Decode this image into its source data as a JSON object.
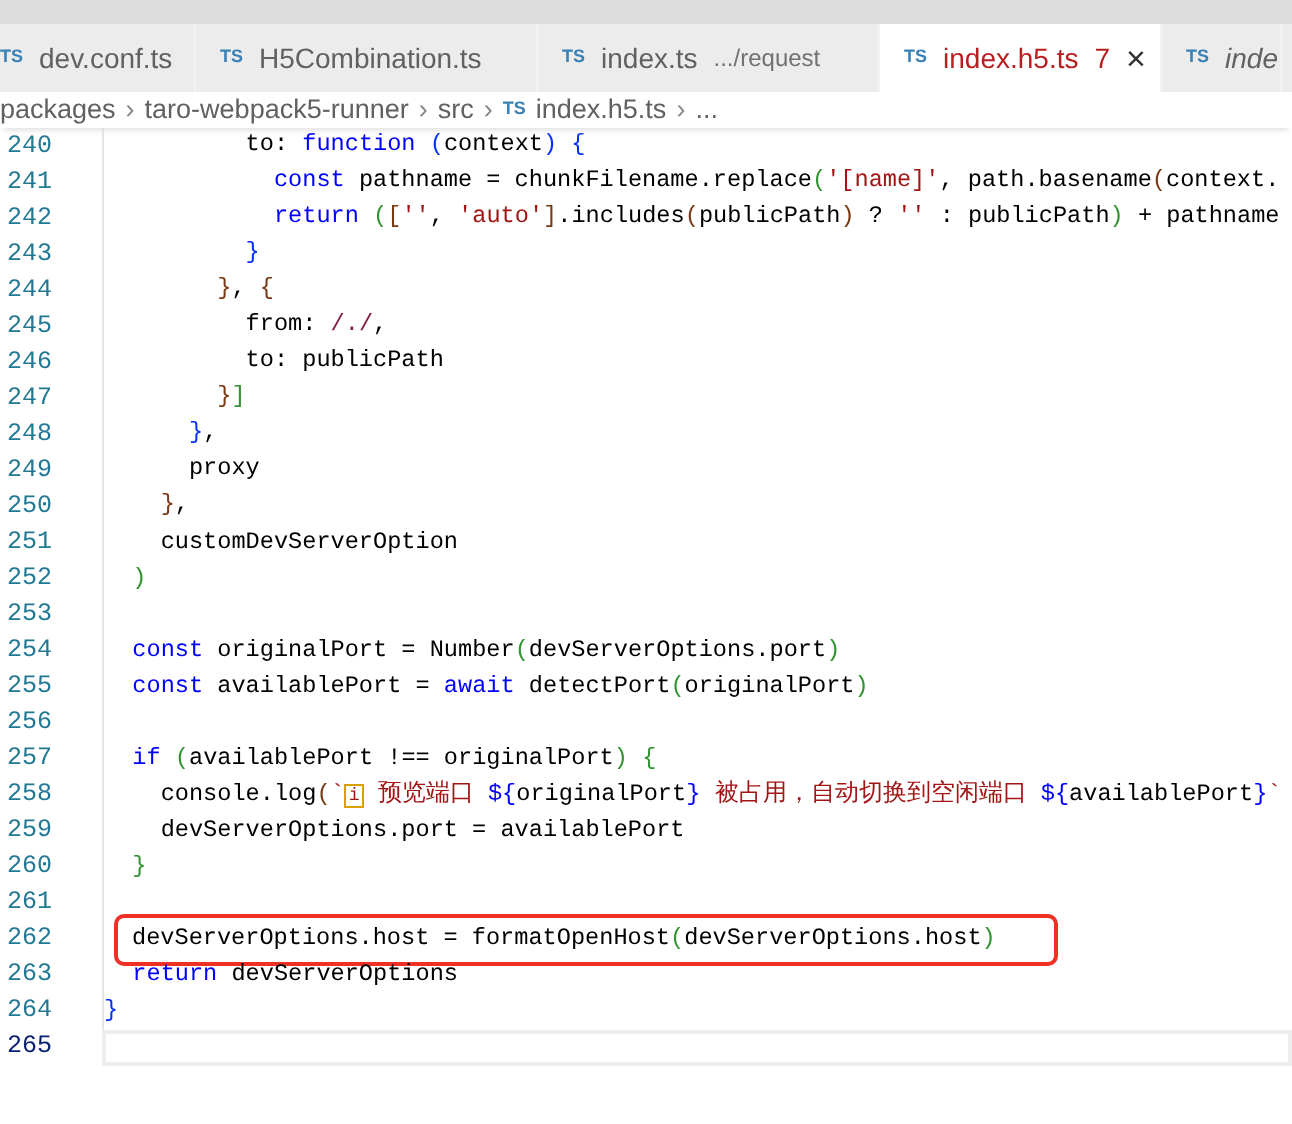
{
  "tabs": [
    {
      "icon_text": "TS",
      "label": "dev.conf.ts",
      "selected": false,
      "preview": false
    },
    {
      "icon_text": "TS",
      "label": "H5Combination.ts",
      "selected": false,
      "preview": false
    },
    {
      "icon_text": "TS",
      "label": "index.ts",
      "description": ".../request",
      "selected": false,
      "preview": false
    },
    {
      "icon_text": "TS",
      "label": "index.h5.ts",
      "problems": "7",
      "selected": true,
      "preview": false,
      "close": "×"
    },
    {
      "icon_text": "TS",
      "label": "inde",
      "selected": false,
      "preview": true
    }
  ],
  "breadcrumbs": [
    {
      "label": "packages"
    },
    {
      "label": "taro-webpack5-runner"
    },
    {
      "label": "src"
    },
    {
      "label": "index.h5.ts",
      "icon_text": "TS"
    },
    {
      "label": "..."
    }
  ],
  "breadcrumb_separator": "›",
  "code_lines": [
    {
      "number": "240",
      "current": false,
      "highlighted": false,
      "tokens": [
        {
          "kind": "plain",
          "text": "          to: "
        },
        {
          "kind": "keyword",
          "text": "function"
        },
        {
          "kind": "bracket1",
          "text": " ("
        },
        {
          "kind": "plain",
          "text": "context"
        },
        {
          "kind": "bracket1",
          "text": ")"
        },
        {
          "kind": "bracket1",
          "text": " {"
        }
      ]
    },
    {
      "number": "241",
      "current": false,
      "highlighted": false,
      "tokens": [
        {
          "kind": "keyword",
          "text": "            const"
        },
        {
          "kind": "plain",
          "text": " pathname = chunkFilename.replace"
        },
        {
          "kind": "bracket2",
          "text": "("
        },
        {
          "kind": "string",
          "text": "'[name]'"
        },
        {
          "kind": "plain",
          "text": ", path.basename"
        },
        {
          "kind": "bracket3",
          "text": "("
        },
        {
          "kind": "plain",
          "text": "context."
        }
      ]
    },
    {
      "number": "242",
      "current": false,
      "highlighted": false,
      "tokens": [
        {
          "kind": "keyword",
          "text": "            return"
        },
        {
          "kind": "bracket2",
          "text": " ("
        },
        {
          "kind": "bracket3",
          "text": "["
        },
        {
          "kind": "string",
          "text": "''"
        },
        {
          "kind": "plain",
          "text": ", "
        },
        {
          "kind": "string",
          "text": "'auto'"
        },
        {
          "kind": "bracket3",
          "text": "]"
        },
        {
          "kind": "plain",
          "text": ".includes"
        },
        {
          "kind": "bracket3",
          "text": "("
        },
        {
          "kind": "plain",
          "text": "publicPath"
        },
        {
          "kind": "bracket3",
          "text": ")"
        },
        {
          "kind": "plain",
          "text": " ? "
        },
        {
          "kind": "string",
          "text": "''"
        },
        {
          "kind": "plain",
          "text": " : publicPath"
        },
        {
          "kind": "bracket2",
          "text": ")"
        },
        {
          "kind": "plain",
          "text": " + pathname"
        }
      ]
    },
    {
      "number": "243",
      "current": false,
      "highlighted": false,
      "tokens": [
        {
          "kind": "bracket1",
          "text": "          }"
        }
      ]
    },
    {
      "number": "244",
      "current": false,
      "highlighted": false,
      "tokens": [
        {
          "kind": "bracket3",
          "text": "        }"
        },
        {
          "kind": "plain",
          "text": ", "
        },
        {
          "kind": "bracket3",
          "text": "{"
        }
      ]
    },
    {
      "number": "245",
      "current": false,
      "highlighted": false,
      "tokens": [
        {
          "kind": "plain",
          "text": "          from: "
        },
        {
          "kind": "regex",
          "text": "/./"
        },
        {
          "kind": "plain",
          "text": ","
        }
      ]
    },
    {
      "number": "246",
      "current": false,
      "highlighted": false,
      "tokens": [
        {
          "kind": "plain",
          "text": "          to: publicPath"
        }
      ]
    },
    {
      "number": "247",
      "current": false,
      "highlighted": false,
      "tokens": [
        {
          "kind": "bracket3",
          "text": "        }"
        },
        {
          "kind": "bracket2",
          "text": "]"
        }
      ]
    },
    {
      "number": "248",
      "current": false,
      "highlighted": false,
      "tokens": [
        {
          "kind": "bracket1",
          "text": "      }"
        },
        {
          "kind": "plain",
          "text": ","
        }
      ]
    },
    {
      "number": "249",
      "current": false,
      "highlighted": false,
      "tokens": [
        {
          "kind": "plain",
          "text": "      proxy"
        }
      ]
    },
    {
      "number": "250",
      "current": false,
      "highlighted": false,
      "tokens": [
        {
          "kind": "bracket3",
          "text": "    }"
        },
        {
          "kind": "plain",
          "text": ","
        }
      ]
    },
    {
      "number": "251",
      "current": false,
      "highlighted": false,
      "tokens": [
        {
          "kind": "plain",
          "text": "    customDevServerOption"
        }
      ]
    },
    {
      "number": "252",
      "current": false,
      "highlighted": false,
      "tokens": [
        {
          "kind": "bracket2",
          "text": "  )"
        }
      ]
    },
    {
      "number": "253",
      "current": false,
      "highlighted": false
    },
    {
      "number": "254",
      "current": false,
      "highlighted": false,
      "tokens": [
        {
          "kind": "keyword",
          "text": "  const"
        },
        {
          "kind": "plain",
          "text": " originalPort = Number"
        },
        {
          "kind": "bracket2",
          "text": "("
        },
        {
          "kind": "plain",
          "text": "devServerOptions.port"
        },
        {
          "kind": "bracket2",
          "text": ")"
        }
      ]
    },
    {
      "number": "255",
      "current": false,
      "highlighted": false,
      "tokens": [
        {
          "kind": "keyword",
          "text": "  const"
        },
        {
          "kind": "plain",
          "text": " availablePort = "
        },
        {
          "kind": "keyword",
          "text": "await"
        },
        {
          "kind": "plain",
          "text": " detectPort"
        },
        {
          "kind": "bracket2",
          "text": "("
        },
        {
          "kind": "plain",
          "text": "originalPort"
        },
        {
          "kind": "bracket2",
          "text": ")"
        }
      ]
    },
    {
      "number": "256",
      "current": false,
      "highlighted": false
    },
    {
      "number": "257",
      "current": false,
      "highlighted": false,
      "tokens": [
        {
          "kind": "keyword",
          "text": "  if"
        },
        {
          "kind": "bracket2",
          "text": " ("
        },
        {
          "kind": "plain",
          "text": "availablePort !== originalPort"
        },
        {
          "kind": "bracket2",
          "text": ")"
        },
        {
          "kind": "bracket2",
          "text": " {"
        }
      ]
    },
    {
      "number": "258",
      "current": false,
      "highlighted": false,
      "tokens": [
        {
          "kind": "plain",
          "text": "    console.log"
        },
        {
          "kind": "bracket3",
          "text": "("
        },
        {
          "kind": "string",
          "text": "`"
        },
        {
          "kind": "glyph",
          "text": "i"
        },
        {
          "kind": "string",
          "text": " 预览端口 "
        },
        {
          "kind": "keyword",
          "text": "${"
        },
        {
          "kind": "plain",
          "text": "originalPort"
        },
        {
          "kind": "keyword",
          "text": "}"
        },
        {
          "kind": "string",
          "text": " 被占用，自动切换到空闲端口 "
        },
        {
          "kind": "keyword",
          "text": "${"
        },
        {
          "kind": "plain",
          "text": "availablePort"
        },
        {
          "kind": "keyword",
          "text": "}"
        },
        {
          "kind": "string",
          "text": "`"
        }
      ]
    },
    {
      "number": "259",
      "current": false,
      "highlighted": false,
      "tokens": [
        {
          "kind": "plain",
          "text": "    devServerOptions.port = availablePort"
        }
      ]
    },
    {
      "number": "260",
      "current": false,
      "highlighted": false,
      "tokens": [
        {
          "kind": "bracket2",
          "text": "  }"
        }
      ]
    },
    {
      "number": "261",
      "current": false,
      "highlighted": false
    },
    {
      "number": "262",
      "current": false,
      "highlighted": true,
      "tokens": [
        {
          "kind": "plain",
          "text": "devServerOptions.host = formatOpenHost"
        },
        {
          "kind": "bracket2",
          "text": "("
        },
        {
          "kind": "plain",
          "text": "devServerOptions.host"
        },
        {
          "kind": "bracket2",
          "text": ")"
        }
      ]
    },
    {
      "number": "263",
      "current": false,
      "highlighted": false,
      "tokens": [
        {
          "kind": "keyword",
          "text": "  return"
        },
        {
          "kind": "plain",
          "text": " devServerOptions"
        }
      ]
    },
    {
      "number": "264",
      "current": false,
      "highlighted": false,
      "tokens": [
        {
          "kind": "bracket1",
          "text": "}"
        }
      ]
    },
    {
      "number": "265",
      "current": true,
      "highlighted": false
    }
  ]
}
